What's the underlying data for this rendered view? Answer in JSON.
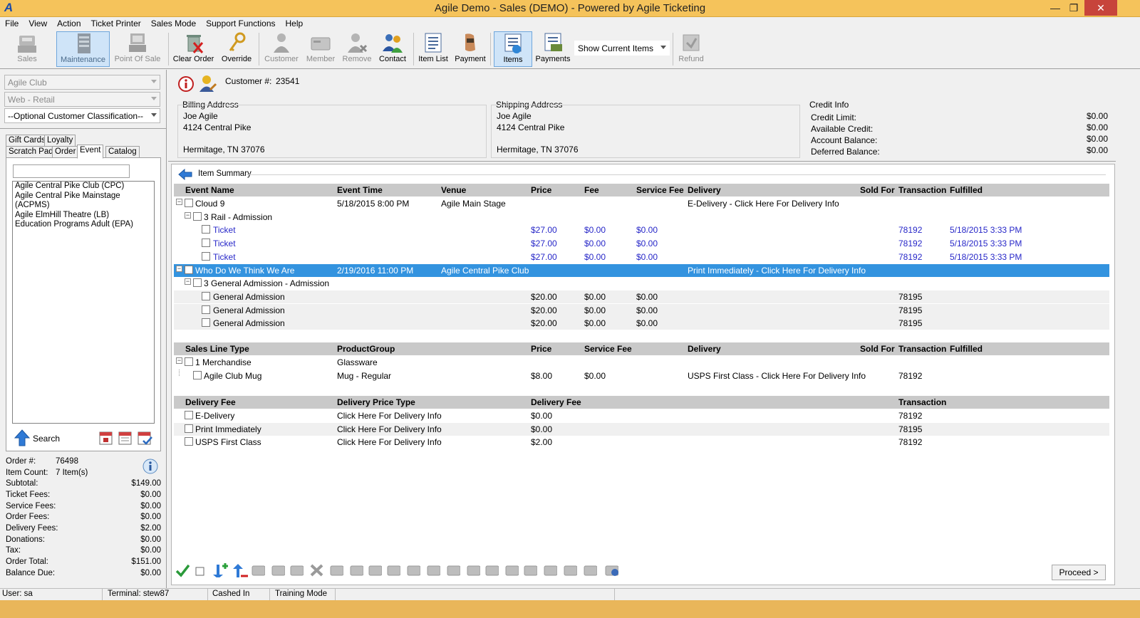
{
  "window": {
    "title": "Agile Demo - Sales (DEMO) - Powered by Agile Ticketing",
    "logo": "A"
  },
  "menu": [
    "File",
    "View",
    "Action",
    "Ticket Printer",
    "Sales Mode",
    "Support Functions",
    "Help"
  ],
  "toolbar": {
    "sales": "Sales",
    "maintenance": "Maintenance",
    "pos": "Point Of Sale",
    "clear_order": "Clear Order",
    "override": "Override",
    "customer": "Customer",
    "member": "Member",
    "remove": "Remove",
    "contact": "Contact",
    "item_list": "Item List",
    "payment": "Payment",
    "items": "Items",
    "payments": "Payments",
    "show_dropdown": "Show Current Items",
    "refund": "Refund"
  },
  "left": {
    "org": "Agile Club",
    "channel": "Web - Retail",
    "classification": "--Optional Customer Classification--",
    "tabs": {
      "gift_cards": "Gift Cards",
      "loyalty": "Loyalty",
      "scratch_pad": "Scratch Pad",
      "order": "Order",
      "event": "Event",
      "catalog": "Catalog"
    },
    "search_value": "",
    "venues": [
      "Agile Central Pike Club  (CPC)",
      "Agile Central Pike Mainstage  (ACPMS)",
      "Agile ElmHill Theatre  (LB)",
      "Education Programs Adult  (EPA)"
    ],
    "search_label": "Search",
    "summary": [
      {
        "label": "Order #:",
        "value": "76498"
      },
      {
        "label": "Item Count:",
        "value": "7 Item(s)"
      },
      {
        "label": "Subtotal:",
        "value": "$149.00"
      },
      {
        "label": "Ticket Fees:",
        "value": "$0.00"
      },
      {
        "label": "Service Fees:",
        "value": "$0.00"
      },
      {
        "label": "Order Fees:",
        "value": "$0.00"
      },
      {
        "label": "Delivery Fees:",
        "value": "$2.00"
      },
      {
        "label": "Donations:",
        "value": "$0.00"
      },
      {
        "label": "Tax:",
        "value": "$0.00"
      },
      {
        "label": "Order Total:",
        "value": "$151.00"
      },
      {
        "label": "Balance Due:",
        "value": "$0.00"
      }
    ]
  },
  "customer": {
    "label": "Customer #:",
    "number": "23541",
    "billing": {
      "title": "Billing Address",
      "name": "Joe Agile",
      "street": "4124 Central Pike",
      "city": "Hermitage, TN 37076"
    },
    "shipping": {
      "title": "Shipping Address",
      "name": "Joe Agile",
      "street": "4124 Central Pike",
      "city": "Hermitage, TN 37076"
    },
    "credit": {
      "title": "Credit Info",
      "rows": [
        {
          "label": "Credit Limit:",
          "value": "$0.00"
        },
        {
          "label": "Available Credit:",
          "value": "$0.00"
        },
        {
          "label": "Account Balance:",
          "value": "$0.00"
        },
        {
          "label": "Deferred Balance:",
          "value": "$0.00"
        }
      ]
    }
  },
  "item_summary": "Item Summary",
  "events": {
    "headers": {
      "name": "Event Name",
      "time": "Event Time",
      "venue": "Venue",
      "price": "Price",
      "fee": "Fee",
      "service_fee": "Service Fee",
      "delivery": "Delivery",
      "sold_for": "Sold For",
      "transaction": "Transaction",
      "fulfilled": "Fulfilled"
    },
    "rows": [
      {
        "name": "Cloud 9",
        "time": "5/18/2015 8:00 PM",
        "venue": "Agile Main Stage",
        "delivery": "E-Delivery - Click Here For Delivery Info"
      },
      {
        "name": "3 Rail - Admission"
      },
      {
        "name": "Ticket",
        "price": "$27.00",
        "fee": "$0.00",
        "service_fee": "$0.00",
        "transaction": "78192",
        "fulfilled": "5/18/2015 3:33 PM"
      },
      {
        "name": "Ticket",
        "price": "$27.00",
        "fee": "$0.00",
        "service_fee": "$0.00",
        "transaction": "78192",
        "fulfilled": "5/18/2015 3:33 PM"
      },
      {
        "name": "Ticket",
        "price": "$27.00",
        "fee": "$0.00",
        "service_fee": "$0.00",
        "transaction": "78192",
        "fulfilled": "5/18/2015 3:33 PM"
      },
      {
        "name": "Who Do We Think We Are",
        "time": "2/19/2016 11:00 PM",
        "venue": "Agile Central Pike Club",
        "delivery": "Print Immediately - Click Here For Delivery Info"
      },
      {
        "name": "3 General Admission - Admission"
      },
      {
        "name": "General Admission",
        "price": "$20.00",
        "fee": "$0.00",
        "service_fee": "$0.00",
        "transaction": "78195"
      },
      {
        "name": "General Admission",
        "price": "$20.00",
        "fee": "$0.00",
        "service_fee": "$0.00",
        "transaction": "78195"
      },
      {
        "name": "General Admission",
        "price": "$20.00",
        "fee": "$0.00",
        "service_fee": "$0.00",
        "transaction": "78195"
      }
    ]
  },
  "merch": {
    "headers": {
      "type": "Sales Line Type",
      "group": "ProductGroup",
      "price": "Price",
      "service_fee": "Service Fee",
      "delivery": "Delivery",
      "sold_for": "Sold For",
      "transaction": "Transaction",
      "fulfilled": "Fulfilled"
    },
    "rows": [
      {
        "type": "1 Merchandise",
        "group": "Glassware"
      },
      {
        "type": "Agile Club Mug",
        "group": "Mug - Regular",
        "price": "$8.00",
        "service_fee": "$0.00",
        "delivery": "USPS First Class - Click Here For Delivery Info",
        "transaction": "78192"
      }
    ]
  },
  "delivery": {
    "headers": {
      "fee": "Delivery Fee",
      "price_type": "Delivery Price Type",
      "amount": "Delivery Fee",
      "transaction": "Transaction"
    },
    "rows": [
      {
        "fee": "E-Delivery",
        "price_type": "Click Here For Delivery Info",
        "amount": "$0.00",
        "transaction": "78192"
      },
      {
        "fee": "Print Immediately",
        "price_type": "Click Here For Delivery Info",
        "amount": "$0.00",
        "transaction": "78195"
      },
      {
        "fee": "USPS First Class",
        "price_type": "Click Here For Delivery Info",
        "amount": "$2.00",
        "transaction": "78192"
      }
    ]
  },
  "proceed": "Proceed >",
  "status": {
    "user": "User: sa",
    "terminal": "Terminal: stew87",
    "cashed": "Cashed In",
    "mode": "Training Mode"
  }
}
